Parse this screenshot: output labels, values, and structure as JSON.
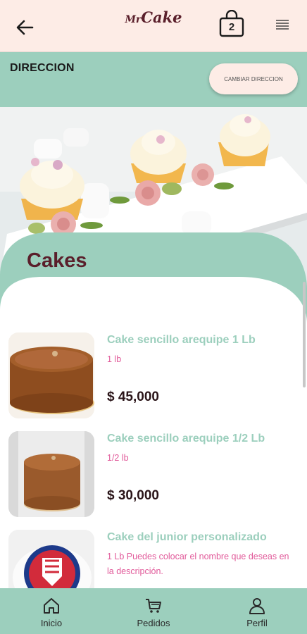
{
  "header": {
    "logo_mr": "Mr",
    "logo_cake": "Cake",
    "cart_count": "2"
  },
  "address": {
    "title": "DIRECCION",
    "change_button": "CAMBIAR DIRECCION"
  },
  "section_title": "Cakes",
  "products": [
    {
      "name": "Cake sencillo arequipe 1 Lb",
      "description": "1 lb",
      "price": "$ 45,000"
    },
    {
      "name": "Cake sencillo arequipe 1/2 Lb",
      "description": "1/2 lb",
      "price": "$ 30,000"
    },
    {
      "name": "Cake del junior personalizado",
      "description": "1 Lb Puedes colocar el nombre que deseas en la descripción.",
      "price": ""
    }
  ],
  "nav": {
    "items": [
      {
        "label": "Inicio",
        "icon": "home-icon"
      },
      {
        "label": "Pedidos",
        "icon": "cart-icon"
      },
      {
        "label": "Perfil",
        "icon": "user-icon"
      }
    ]
  },
  "colors": {
    "mint": "#9ccfbd",
    "cream": "#fdece6",
    "maroon": "#5a1f2b",
    "pink": "#e15a9a"
  }
}
